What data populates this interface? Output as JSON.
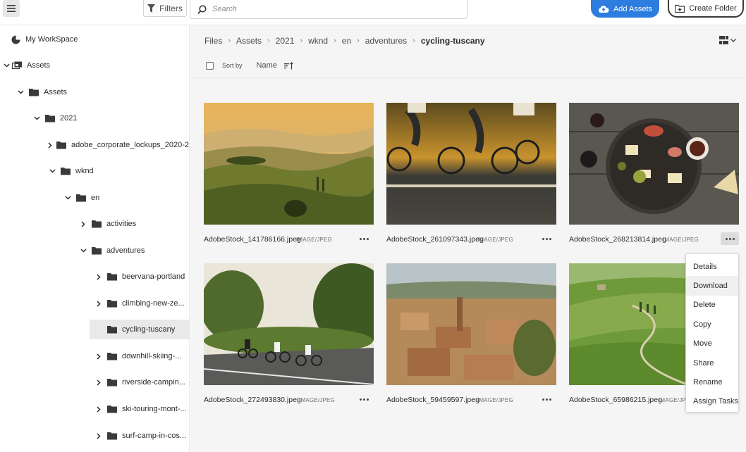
{
  "topbar": {
    "menu_icon": "hamburger-icon",
    "filters_label": "Filters",
    "search_placeholder": "Search",
    "add_assets_label": "Add Assets",
    "create_folder_label": "Create Folder"
  },
  "sidebar": {
    "items": [
      {
        "label": "My WorkSpace",
        "icon": "workspace-icon"
      },
      {
        "label": "Assets",
        "icon": "assets-icon",
        "expanded": true
      },
      {
        "label": "Assets",
        "icon": "folder-icon",
        "expanded": true
      },
      {
        "label": "2021",
        "icon": "folder-icon",
        "expanded": true
      },
      {
        "label": "adobe_corporate_lockups_2020-2",
        "icon": "folder-icon",
        "expanded": false
      },
      {
        "label": "wknd",
        "icon": "folder-icon",
        "expanded": true
      },
      {
        "label": "en",
        "icon": "folder-icon",
        "expanded": true
      },
      {
        "label": "activities",
        "icon": "folder-icon",
        "expanded": false
      },
      {
        "label": "adventures",
        "icon": "folder-icon",
        "expanded": true
      },
      {
        "label": "beervana-portland",
        "icon": "folder-icon",
        "expanded": false
      },
      {
        "label": "climbing-new-ze...",
        "icon": "folder-icon",
        "expanded": false
      },
      {
        "label": "cycling-tuscany",
        "icon": "folder-icon",
        "selected": true
      },
      {
        "label": "downhill-skiing-...",
        "icon": "folder-icon",
        "expanded": false
      },
      {
        "label": "riverside-campin...",
        "icon": "folder-icon",
        "expanded": false
      },
      {
        "label": "ski-touring-mont-...",
        "icon": "folder-icon",
        "expanded": false
      },
      {
        "label": "surf-camp-in-cos...",
        "icon": "folder-icon",
        "expanded": false
      }
    ]
  },
  "breadcrumb": [
    "Files",
    "Assets",
    "2021",
    "wknd",
    "en",
    "adventures",
    "cycling-tuscany"
  ],
  "sortbar": {
    "sort_by_label": "Sort by",
    "sort_field": "Name"
  },
  "assets": [
    {
      "name": "AdobeStock_141786166.jpeg",
      "type": "IMAGE/JPEG"
    },
    {
      "name": "AdobeStock_261097343.jpeg",
      "type": "IMAGE/JPEG"
    },
    {
      "name": "AdobeStock_268213814.jpeg",
      "type": "IMAGE/JPEG"
    },
    {
      "name": "AdobeStock_272493830.jpeg",
      "type": "IMAGE/JPEG"
    },
    {
      "name": "AdobeStock_59459597.jpeg",
      "type": "IMAGE/JPEG"
    },
    {
      "name": "AdobeStock_65986215.jpeg",
      "type": "IMAGE/JPEG"
    }
  ],
  "context_menu": [
    "Details",
    "Download",
    "Delete",
    "Copy",
    "Move",
    "Share",
    "Rename",
    "Assign Tasks"
  ],
  "colors": {
    "accent": "#2d7de0",
    "selected_row": "#e9e9e9",
    "content_bg": "#f5f5f5"
  }
}
